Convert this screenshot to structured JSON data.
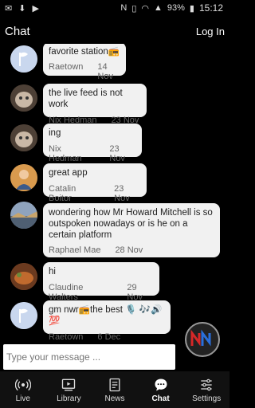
{
  "status": {
    "battery": "93%",
    "time": "15:12",
    "battery_icon": "battery-icon",
    "wifi_icon": "wifi-icon"
  },
  "header": {
    "title": "Chat",
    "login": "Log In"
  },
  "messages": [
    {
      "text": "favorite station📻",
      "author": "Raetown",
      "date": "14 Nov",
      "avatar": "flag"
    },
    {
      "text": "the live feed is not work",
      "author": "Nix Hedman",
      "date": "23 Nov",
      "avatar": "cat"
    },
    {
      "text": "ing",
      "author": "Nix Hedman",
      "date": "23 Nov",
      "avatar": "cat"
    },
    {
      "text": "great app",
      "author": "Catalin Boitor",
      "date": "23 Nov",
      "avatar": "person"
    },
    {
      "text": "wondering how Mr Howard Mitchell is so outspoken nowadays or is he on a certain platform",
      "author": "Raphael Mae",
      "date": "28 Nov",
      "avatar": "landscape"
    },
    {
      "text": "hi",
      "author": "Claudine Walters",
      "date": "29 Nov",
      "avatar": "food"
    },
    {
      "text": "gm nwr📻the best 🎙️ 🎶🔊💯",
      "author": "Raetown",
      "date": "6 Dec",
      "avatar": "flag"
    }
  ],
  "input": {
    "placeholder": "Type your message ..."
  },
  "nav": [
    {
      "label": "Live",
      "icon": "radio-icon"
    },
    {
      "label": "Library",
      "icon": "library-icon"
    },
    {
      "label": "News",
      "icon": "news-icon"
    },
    {
      "label": "Chat",
      "icon": "chat-icon"
    },
    {
      "label": "Settings",
      "icon": "settings-icon"
    }
  ]
}
